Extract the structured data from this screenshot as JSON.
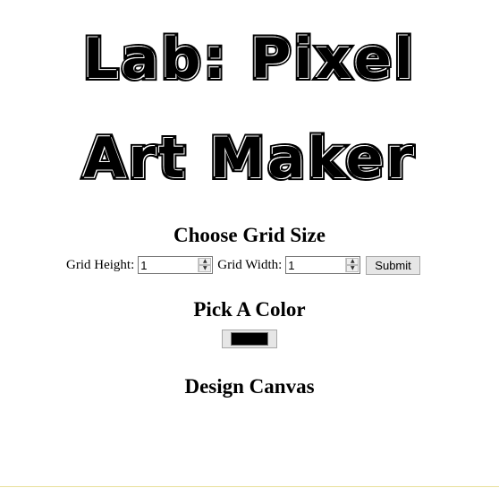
{
  "title": {
    "line1": "Lab: Pixel",
    "line2": "Art Maker"
  },
  "grid_section": {
    "heading": "Choose Grid Size",
    "height_label": "Grid Height:",
    "height_value": "1",
    "width_label": "Grid Width:",
    "width_value": "1",
    "submit_label": "Submit"
  },
  "color_section": {
    "heading": "Pick A Color",
    "selected_color": "#000000"
  },
  "canvas_section": {
    "heading": "Design Canvas"
  },
  "icons": {
    "spinner_up": "spinner-up-arrow-icon",
    "spinner_down": "spinner-down-arrow-icon"
  }
}
